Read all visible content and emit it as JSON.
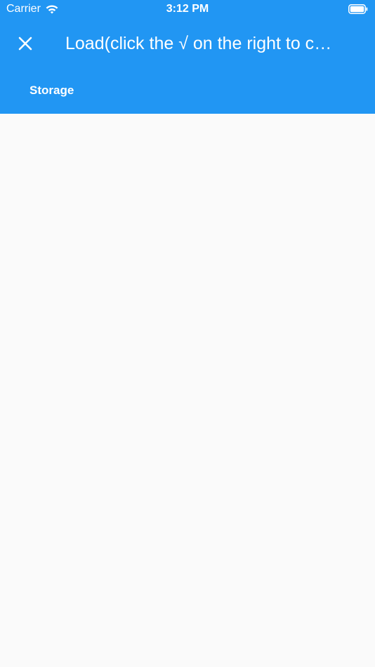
{
  "status_bar": {
    "carrier": "Carrier",
    "time": "3:12 PM"
  },
  "app_bar": {
    "title": "Load(click the √ on the right to confirm)",
    "close_icon": "close-icon",
    "background_color": "#2196f3"
  },
  "tabs": [
    {
      "label": "Storage"
    }
  ]
}
